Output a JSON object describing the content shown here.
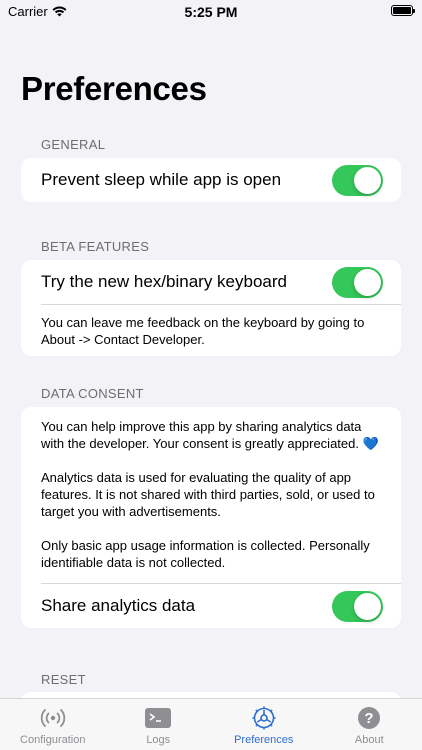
{
  "status_bar": {
    "carrier": "Carrier",
    "time": "5:25 PM"
  },
  "title": "Preferences",
  "sections": {
    "general": {
      "header": "GENERAL",
      "rows": [
        {
          "label": "Prevent sleep while app is open",
          "on": true
        }
      ]
    },
    "beta": {
      "header": "BETA FEATURES",
      "rows": [
        {
          "label": "Try the new hex/binary keyboard",
          "on": true
        }
      ],
      "note": "You can leave me feedback on the keyboard by going to About -> Contact Developer."
    },
    "consent": {
      "header": "DATA CONSENT",
      "paragraphs": [
        "You can help improve this app by sharing analytics data with the developer. Your consent is greatly appreciated. 💙",
        "Analytics data is used for evaluating the quality of app features. It is not shared with third parties, sold, or used to target you with advertisements.",
        "Only basic app usage information is collected. Personally identifiable data is not collected."
      ],
      "rows": [
        {
          "label": "Share analytics data",
          "on": true
        }
      ]
    },
    "reset": {
      "header": "RESET"
    }
  },
  "tabs": [
    {
      "label": "Configuration",
      "icon": "antenna-icon",
      "active": false
    },
    {
      "label": "Logs",
      "icon": "terminal-icon",
      "active": false
    },
    {
      "label": "Preferences",
      "icon": "settings-icon",
      "active": true
    },
    {
      "label": "About",
      "icon": "question-icon",
      "active": false
    }
  ],
  "colors": {
    "accent": "#2f6fd0",
    "toggle_on": "#34c759",
    "background": "#f2f2f7"
  }
}
